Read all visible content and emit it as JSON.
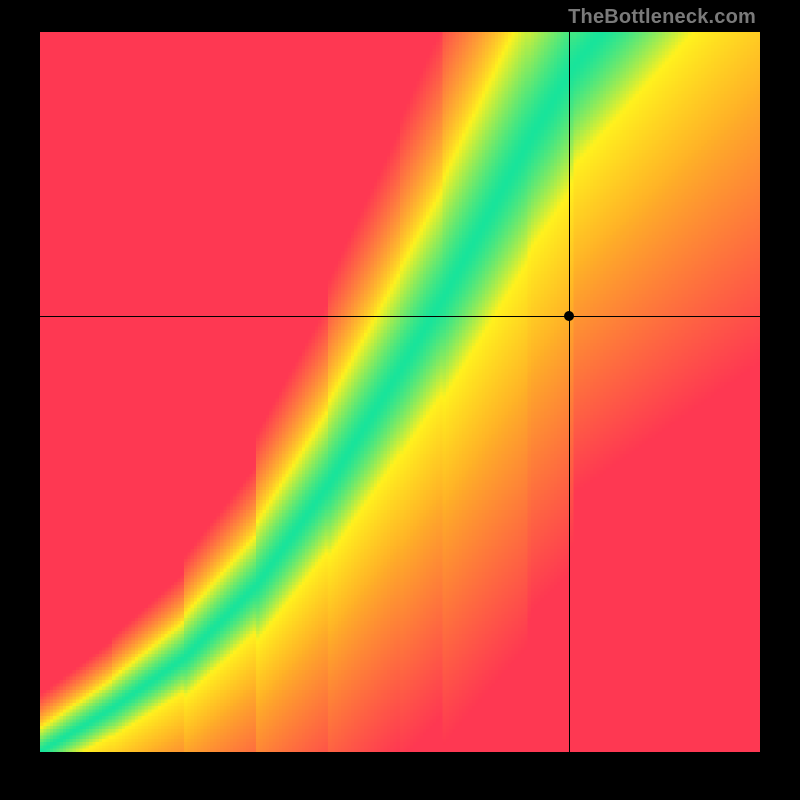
{
  "watermark": "TheBottleneck.com",
  "chart_data": {
    "type": "heatmap",
    "title": "",
    "xlabel": "",
    "ylabel": "",
    "xlim": [
      0,
      1
    ],
    "ylim": [
      0,
      1
    ],
    "grid": false,
    "legend": false,
    "colorscale": {
      "low": "#fe3852",
      "mid_low": "#ff8a29",
      "mid": "#fff21e",
      "optimal": "#18e49b",
      "mid_high": "#fff21e",
      "high": "#ffb227"
    },
    "ridge": {
      "description": "Green optimal band following a superlinear curve from bottom-left to upper area",
      "points": [
        {
          "x": 0.0,
          "y": 0.0
        },
        {
          "x": 0.1,
          "y": 0.06
        },
        {
          "x": 0.2,
          "y": 0.13
        },
        {
          "x": 0.3,
          "y": 0.23
        },
        {
          "x": 0.4,
          "y": 0.37
        },
        {
          "x": 0.5,
          "y": 0.53
        },
        {
          "x": 0.56,
          "y": 0.63
        },
        {
          "x": 0.62,
          "y": 0.74
        },
        {
          "x": 0.68,
          "y": 0.85
        },
        {
          "x": 0.74,
          "y": 0.95
        },
        {
          "x": 0.78,
          "y": 1.0
        }
      ],
      "half_width": 0.045
    },
    "marker": {
      "x": 0.735,
      "y": 0.605,
      "note": "black dot at crosshair intersection; falls in yellow/orange region right of the green ridge"
    },
    "crosshair": {
      "x": 0.735,
      "y": 0.605
    },
    "resolution": 220
  }
}
